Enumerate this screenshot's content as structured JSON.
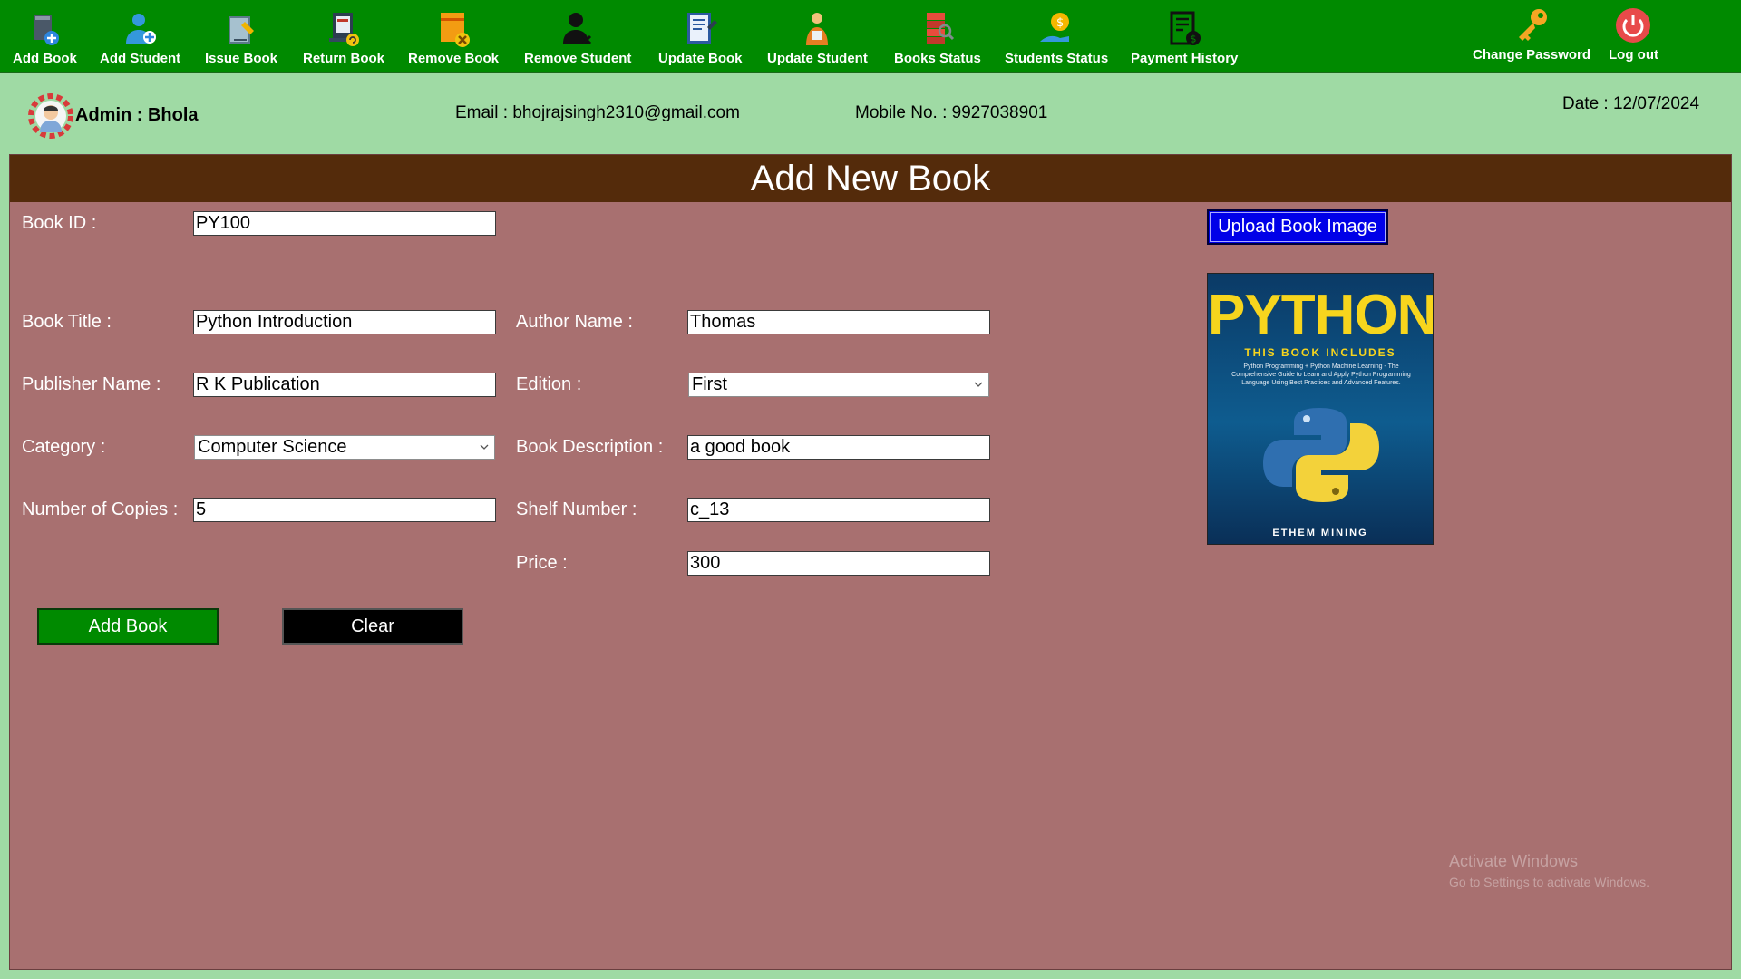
{
  "toolbar": {
    "items": [
      {
        "label": "Add Book",
        "icon": "add-book-icon"
      },
      {
        "label": "Add Student",
        "icon": "add-student-icon"
      },
      {
        "label": "Issue Book",
        "icon": "issue-book-icon"
      },
      {
        "label": "Return Book",
        "icon": "return-book-icon"
      },
      {
        "label": "Remove Book",
        "icon": "remove-book-icon"
      },
      {
        "label": "Remove Student",
        "icon": "remove-student-icon"
      },
      {
        "label": "Update Book",
        "icon": "update-book-icon"
      },
      {
        "label": "Update Student",
        "icon": "update-student-icon"
      },
      {
        "label": "Books Status",
        "icon": "books-status-icon"
      },
      {
        "label": "Students Status",
        "icon": "students-status-icon"
      },
      {
        "label": "Payment History",
        "icon": "payment-history-icon"
      }
    ],
    "change_password": {
      "label": "Change Password",
      "icon": "key-icon"
    },
    "logout": {
      "label": "Log out",
      "icon": "power-icon"
    }
  },
  "info": {
    "admin": "Admin : Bhola",
    "email": "Email : bhojrajsingh2310@gmail.com",
    "mobile": "Mobile No. : 9927038901",
    "date": "Date : 12/07/2024"
  },
  "form": {
    "title": "Add New Book",
    "book_id": {
      "label": "Book ID :",
      "value": "PY100"
    },
    "book_title": {
      "label": "Book Title :",
      "value": "Python Introduction"
    },
    "author_name": {
      "label": "Author Name :",
      "value": "Thomas"
    },
    "publisher_name": {
      "label": "Publisher Name :",
      "value": "R K Publication"
    },
    "edition": {
      "label": "Edition :",
      "value": "First"
    },
    "category": {
      "label": "Category :",
      "value": "Computer Science"
    },
    "book_description": {
      "label": "Book Description :",
      "value": "a good book"
    },
    "copies": {
      "label": "Number of Copies :",
      "value": "5"
    },
    "shelf_number": {
      "label": "Shelf Number :",
      "value": "c_13"
    },
    "price": {
      "label": "Price :",
      "value": "300"
    },
    "add_button": "Add Book",
    "clear_button": "Clear",
    "upload_button": "Upload Book Image"
  },
  "cover": {
    "title": "PYTHON",
    "subtitle": "THIS BOOK INCLUDES",
    "description": "Python Programming + Python Machine Learning - The Comprehensive Guide to Learn and Apply Python Programming Language Using Best Practices and Advanced Features.",
    "author": "ETHEM MINING"
  },
  "watermark": {
    "title": "Activate Windows",
    "subtitle": "Go to Settings to activate Windows."
  },
  "colors": {
    "toolbar_bg": "#008a00",
    "page_bg": "#9fdaa4",
    "panel_bg": "#a87070",
    "header_bg": "#542b0b",
    "upload_btn": "#0000e8"
  }
}
